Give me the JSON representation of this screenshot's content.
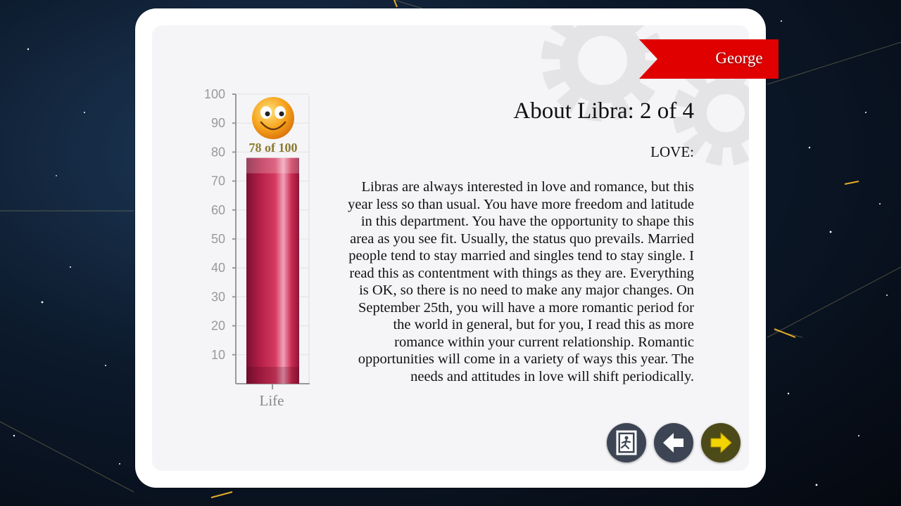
{
  "user": {
    "name": "George"
  },
  "page": {
    "title": "About Libra: 2 of 4",
    "section": "LOVE:",
    "body": "Libras are always interested in love and romance, but this year less so than usual. You have more freedom and latitude in this department. You have the opportunity to shape this area as you see fit. Usually, the status quo prevails. Married people tend to stay married and singles tend to stay single. I read this as contentment with things as they are. Everything is OK, so there is no need to make any major changes. On September 25th, you will have a more romantic period for the world in general, but for you, I read this as more romance within your current relationship. Romantic opportunities will come in a variety of ways this year. The needs and attitudes in love will shift periodically."
  },
  "meter": {
    "value": 78,
    "max": 100,
    "score_label": "78 of 100",
    "axis_label": "Life",
    "ticks": [
      "100",
      "90",
      "80",
      "70",
      "60",
      "50",
      "40",
      "30",
      "20",
      "10"
    ],
    "mood_icon": "smiley-face-icon",
    "bar_color": "#c2264a"
  },
  "buttons": {
    "exit_icon": "exit-door-icon",
    "prev_icon": "arrow-left-icon",
    "next_icon": "arrow-right-icon",
    "next_color": "#f2d400"
  },
  "colors": {
    "ribbon": "#e00000",
    "card": "#ffffff"
  }
}
